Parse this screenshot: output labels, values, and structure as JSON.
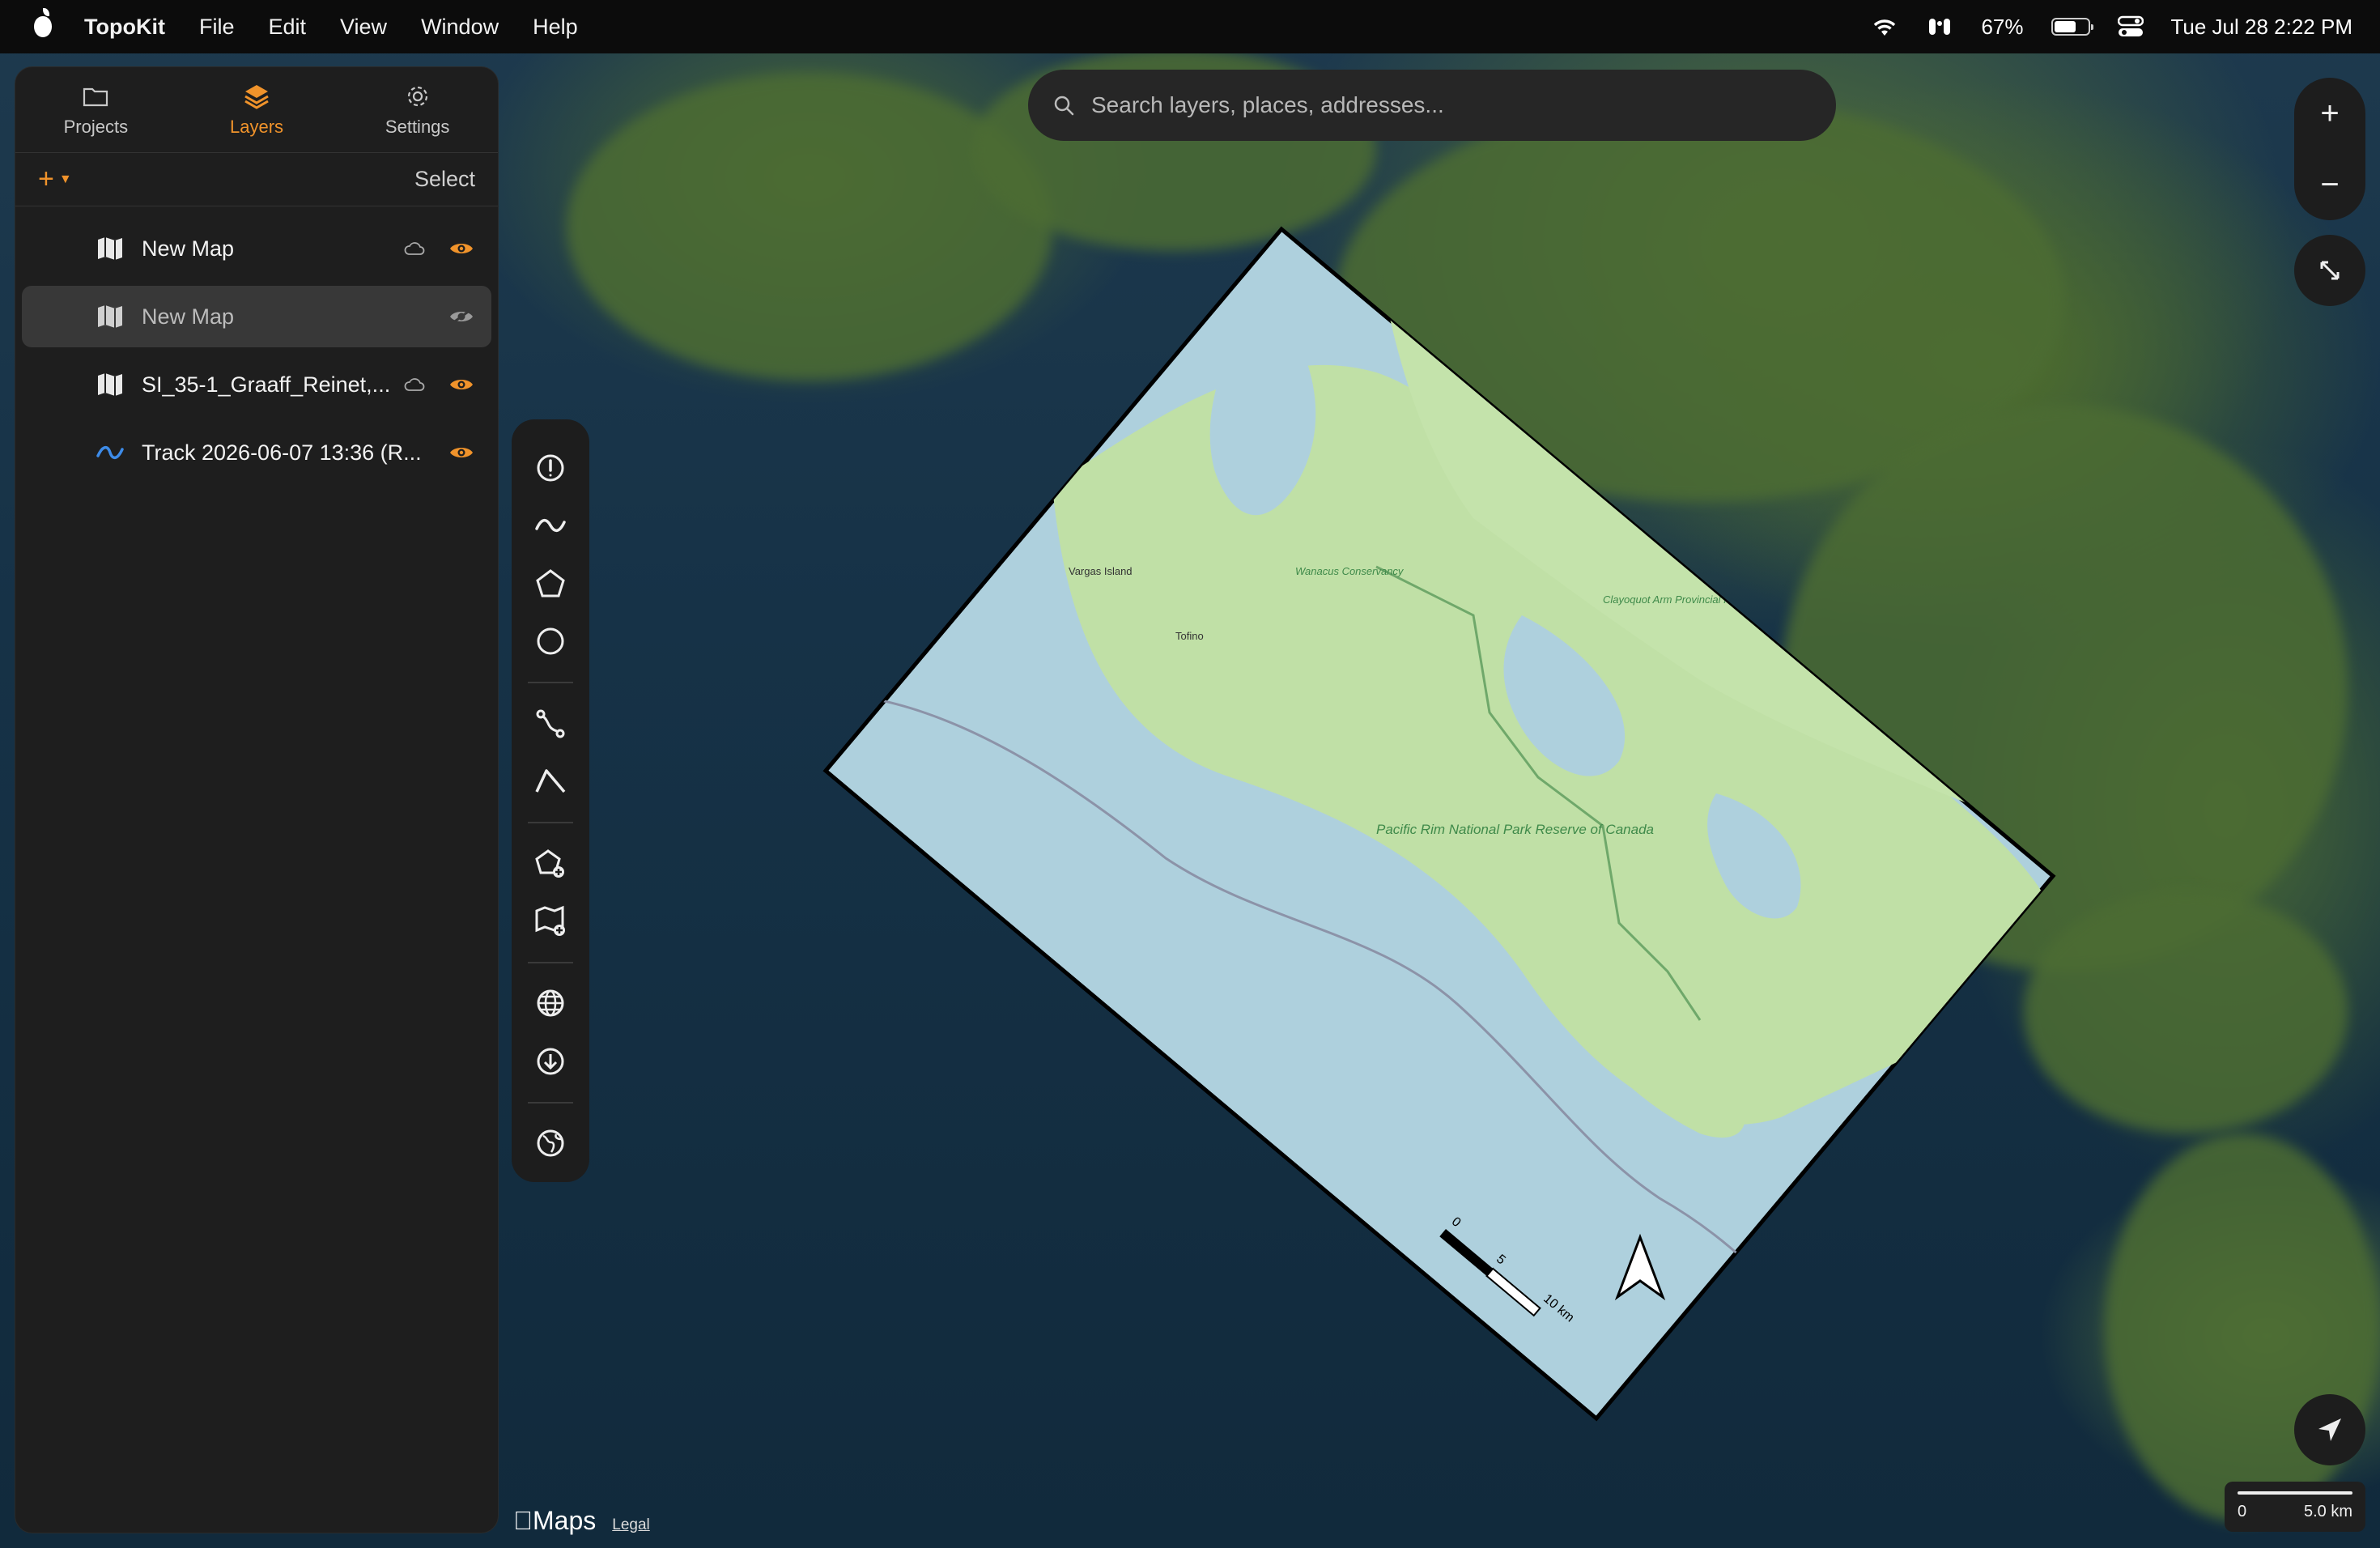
{
  "menubar": {
    "app_name": "TopoKit",
    "items": [
      "File",
      "Edit",
      "View",
      "Window",
      "Help"
    ],
    "battery_percent": "67%",
    "battery_level": 0.67,
    "datetime": "Tue Jul 28  2:22 PM"
  },
  "sidebar": {
    "tabs": [
      {
        "label": "Projects",
        "icon": "folder-icon",
        "active": false
      },
      {
        "label": "Layers",
        "icon": "layers-icon",
        "active": true
      },
      {
        "label": "Settings",
        "icon": "gear-icon",
        "active": false
      }
    ],
    "add_label": "+",
    "select_label": "Select",
    "layers": [
      {
        "name": "New Map",
        "icon": "map-icon",
        "cloud": true,
        "visible": true,
        "selected": false
      },
      {
        "name": "New Map",
        "icon": "map-icon",
        "cloud": false,
        "visible": false,
        "selected": true
      },
      {
        "name": "SI_35-1_Graaff_Reinet,...",
        "icon": "map-icon",
        "cloud": true,
        "visible": true,
        "selected": false
      },
      {
        "name": "Track 2026-06-07 13:36 (R...",
        "icon": "track-icon",
        "cloud": false,
        "visible": true,
        "selected": false
      }
    ]
  },
  "search": {
    "placeholder": "Search layers, places, addresses..."
  },
  "zoom": {
    "in": "+",
    "out": "−"
  },
  "scale": {
    "start": "0",
    "end": "5.0 km"
  },
  "attribution": {
    "maps": "Maps",
    "legal": "Legal"
  },
  "overlay_map": {
    "labels": [
      "Vargas Island",
      "Tofino",
      "Pacific Rim National Park Reserve of Canada",
      "Clayoquot Arm Provincial Park",
      "Wanacus Conservancy"
    ],
    "scale_labels": [
      "0",
      "5",
      "10 km"
    ]
  },
  "colors": {
    "accent": "#f0932b",
    "panel": "#1e1e1e",
    "water": "#aed0dd",
    "land": "#bfe0a8"
  }
}
